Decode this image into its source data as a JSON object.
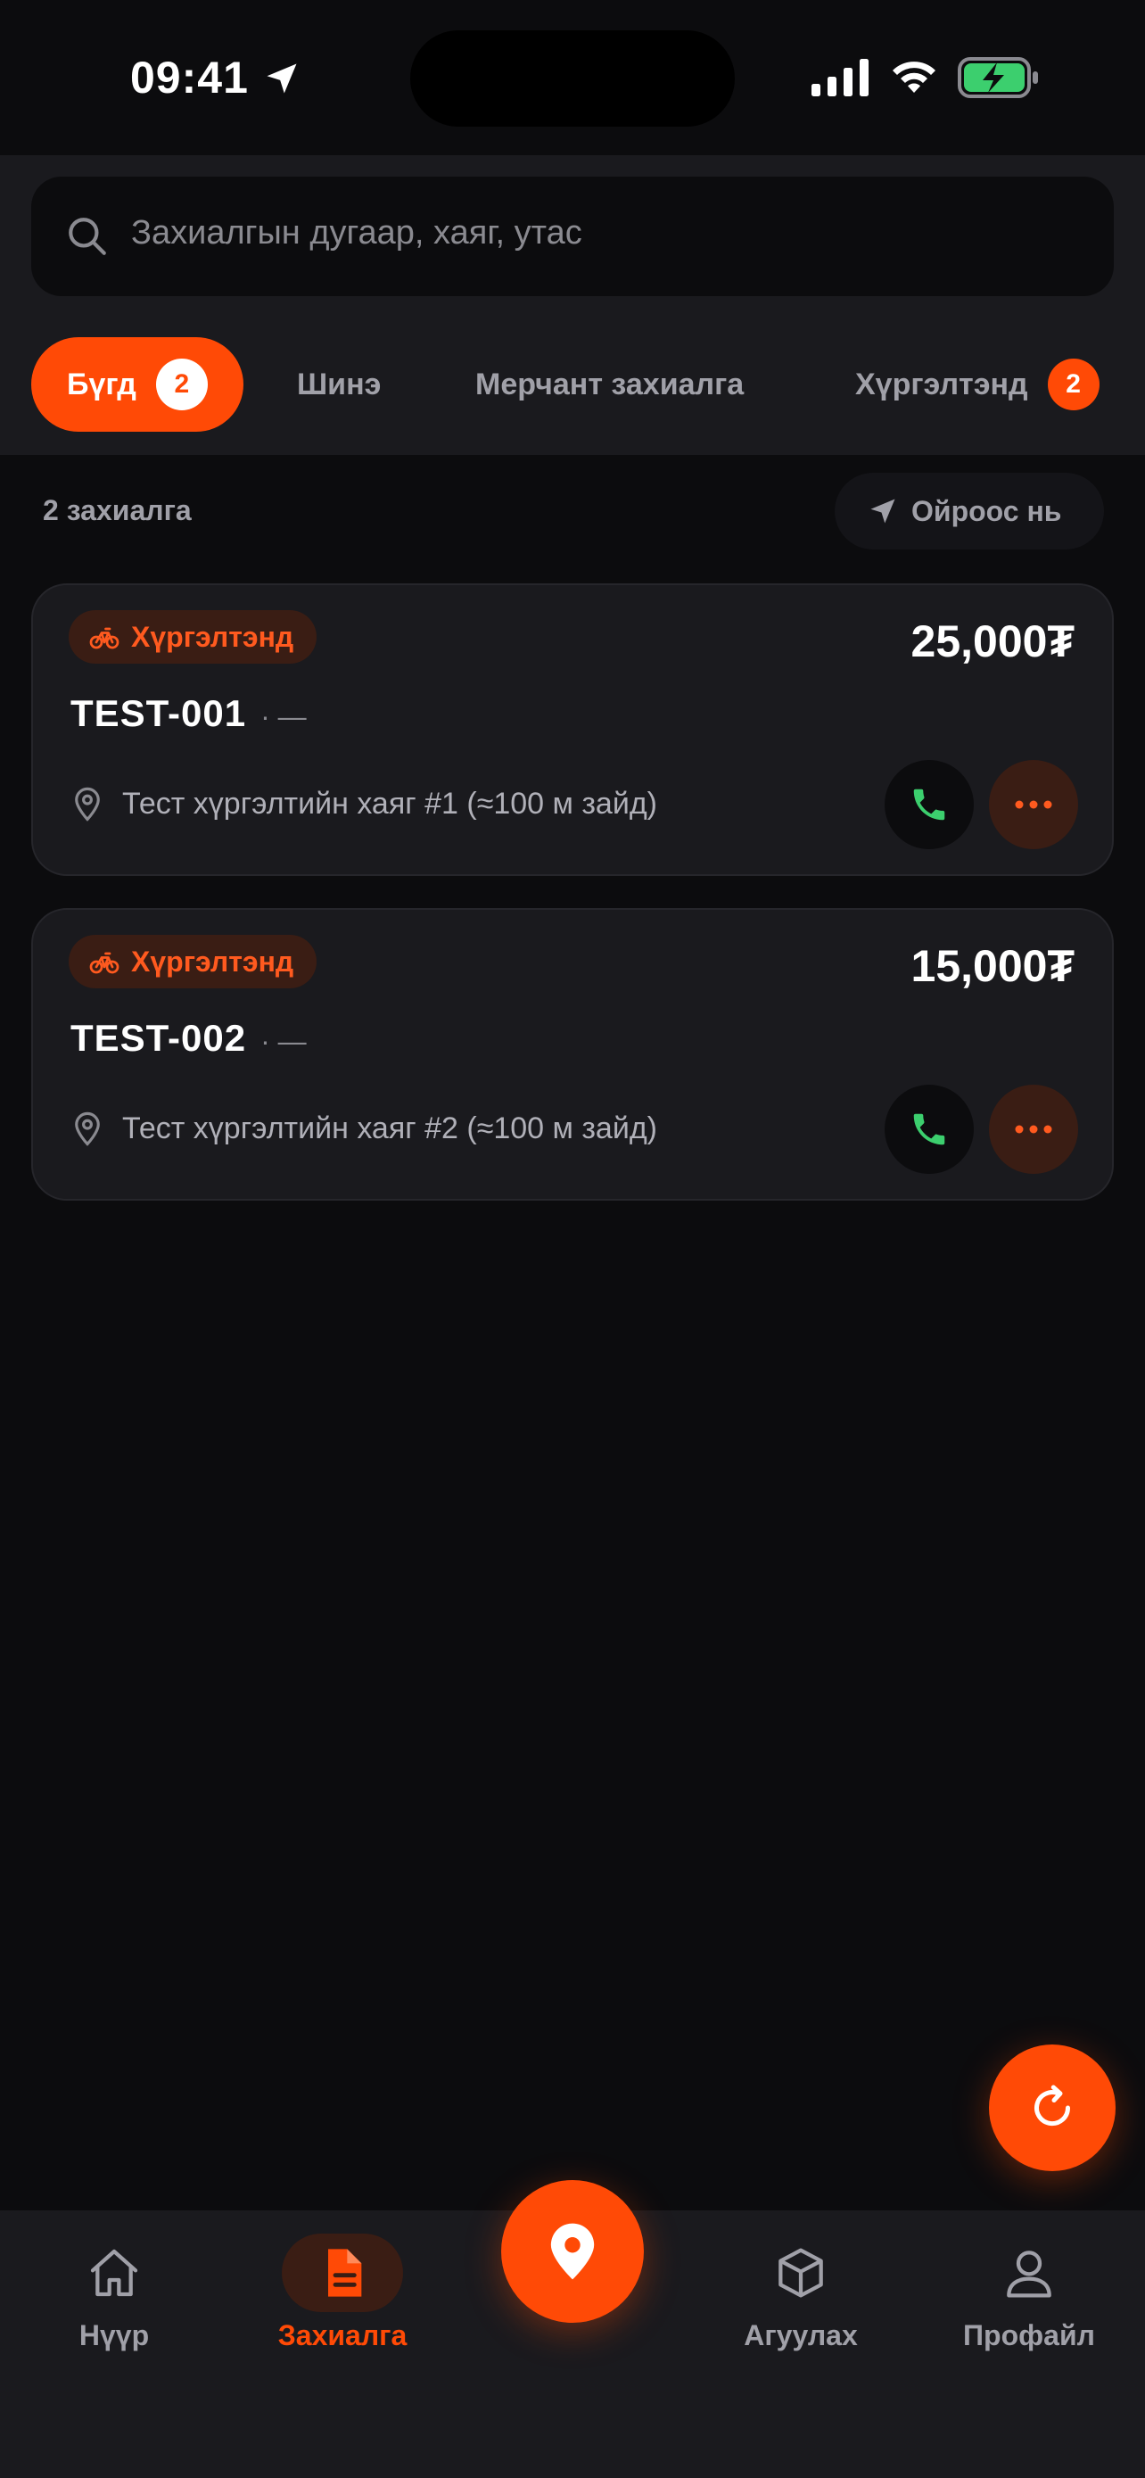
{
  "status_bar": {
    "time": "09:41"
  },
  "search": {
    "placeholder": "Захиалгын дугаар, хаяг, утас"
  },
  "tabs": [
    {
      "label": "Бүгд",
      "badge": "2"
    },
    {
      "label": "Шинэ"
    },
    {
      "label": "Мерчант захиалга"
    },
    {
      "label": "Хүргэлтэнд",
      "badge": "2"
    }
  ],
  "summary": {
    "count_label": "2 захиалга",
    "sort_label": "Ойроос нь"
  },
  "orders": [
    {
      "status": "Хүргэлтэнд",
      "price": "25,000₮",
      "id": "TEST-001",
      "separator": "· —",
      "address": "Тест хүргэлтийн хаяг #1 (≈100 м зайд)"
    },
    {
      "status": "Хүргэлтэнд",
      "price": "15,000₮",
      "id": "TEST-002",
      "separator": "· —",
      "address": "Тест хүргэлтийн хаяг #2 (≈100 м зайд)"
    }
  ],
  "nav": [
    {
      "label": "Нүүр",
      "icon": "home-icon"
    },
    {
      "label": "Захиалга",
      "icon": "document-icon"
    },
    {
      "label": "",
      "icon": "map-pin-icon"
    },
    {
      "label": "Агуулах",
      "icon": "box-icon"
    },
    {
      "label": "Профайл",
      "icon": "user-icon"
    }
  ],
  "colors": {
    "accent": "#ff4a06",
    "background": "#0c0c0e",
    "surface": "#1a1a1e",
    "call_green": "#3ccf6e"
  }
}
